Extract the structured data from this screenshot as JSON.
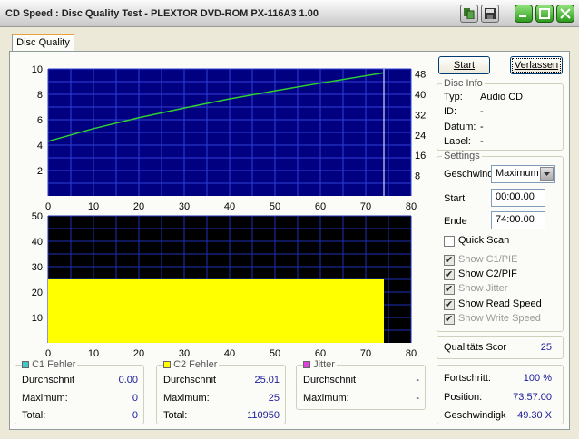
{
  "window": {
    "title": "CD Speed : Disc Quality Test - PLEXTOR DVD-ROM PX-116A3 1.00"
  },
  "tabs": [
    {
      "label": "Disc Quality"
    }
  ],
  "buttons": {
    "start": "Start",
    "exit": "Verlassen"
  },
  "disc_info": {
    "title": "Disc Info",
    "rows": [
      {
        "label": "Typ:",
        "value": "Audio CD"
      },
      {
        "label": "ID:",
        "value": "-"
      },
      {
        "label": "Datum:",
        "value": "-"
      },
      {
        "label": "Label:",
        "value": "-"
      }
    ]
  },
  "settings": {
    "title": "Settings",
    "speed_label": "Geschwind",
    "speed_value": "Maximum",
    "start_label": "Start",
    "start_value": "00:00.00",
    "end_label": "Ende",
    "end_value": "74:00.00",
    "checkboxes": [
      {
        "label": "Quick Scan",
        "checked": false,
        "enabled": true
      },
      {
        "label": "Show C1/PIE",
        "checked": true,
        "enabled": false
      },
      {
        "label": "Show C2/PIF",
        "checked": true,
        "enabled": true
      },
      {
        "label": "Show Jitter",
        "checked": true,
        "enabled": false
      },
      {
        "label": "Show Read Speed",
        "checked": true,
        "enabled": true
      },
      {
        "label": "Show Write Speed",
        "checked": true,
        "enabled": false
      }
    ]
  },
  "quality": {
    "label": "Qualitäts Scor",
    "value": "25"
  },
  "progress": {
    "rows": [
      {
        "label": "Fortschritt:",
        "value": "100 %"
      },
      {
        "label": "Position:",
        "value": "73:57.00"
      },
      {
        "label": "Geschwindigk",
        "value": "49.30 X"
      }
    ]
  },
  "stats": {
    "c1": {
      "title": "C1 Fehler",
      "color": "#40c8c8",
      "rows": [
        {
          "label": "Durchschnit",
          "value": "0.00"
        },
        {
          "label": "Maximum:",
          "value": "0"
        },
        {
          "label": "Total:",
          "value": "0"
        }
      ]
    },
    "c2": {
      "title": "C2 Fehler",
      "color": "#ffff00",
      "rows": [
        {
          "label": "Durchschnit",
          "value": "25.01"
        },
        {
          "label": "Maximum:",
          "value": "25"
        },
        {
          "label": "Total:",
          "value": "110950"
        }
      ]
    },
    "jitter": {
      "title": "Jitter",
      "color": "#e040e0",
      "rows": [
        {
          "label": "Durchschnit",
          "value": "-"
        },
        {
          "label": "Maximum:",
          "value": "-"
        }
      ]
    }
  },
  "chart_data": [
    {
      "type": "line",
      "name_hint": "read-speed",
      "x_ticks": [
        "0",
        "10",
        "20",
        "30",
        "40",
        "50",
        "60",
        "70",
        "80"
      ],
      "y_left_ticks": [
        "2",
        "4",
        "6",
        "8",
        "10"
      ],
      "y_right_ticks": [
        "8",
        "16",
        "24",
        "32",
        "40",
        "48"
      ],
      "xlim": [
        0,
        80
      ],
      "ylim_left": [
        0,
        10
      ],
      "ylim_right": [
        0,
        50
      ],
      "grid": true,
      "background": "#000080",
      "line_color": "#30d030",
      "marker_x": 74,
      "x": [
        0,
        10,
        20,
        30,
        40,
        50,
        60,
        70,
        74
      ],
      "y_right": [
        21.5,
        26.5,
        30.8,
        34.6,
        38.2,
        41.4,
        44.4,
        47.3,
        48.5
      ]
    },
    {
      "type": "bar",
      "name_hint": "c2-errors",
      "x_ticks": [
        "0",
        "10",
        "20",
        "30",
        "40",
        "50",
        "60",
        "70",
        "80"
      ],
      "y_ticks": [
        "10",
        "20",
        "30",
        "40",
        "50"
      ],
      "xlim": [
        0,
        80
      ],
      "ylim": [
        0,
        50
      ],
      "grid": true,
      "background": "#000000",
      "fill_color": "#ffff00",
      "x_start": 0,
      "x_end": 74,
      "value": 25
    }
  ]
}
